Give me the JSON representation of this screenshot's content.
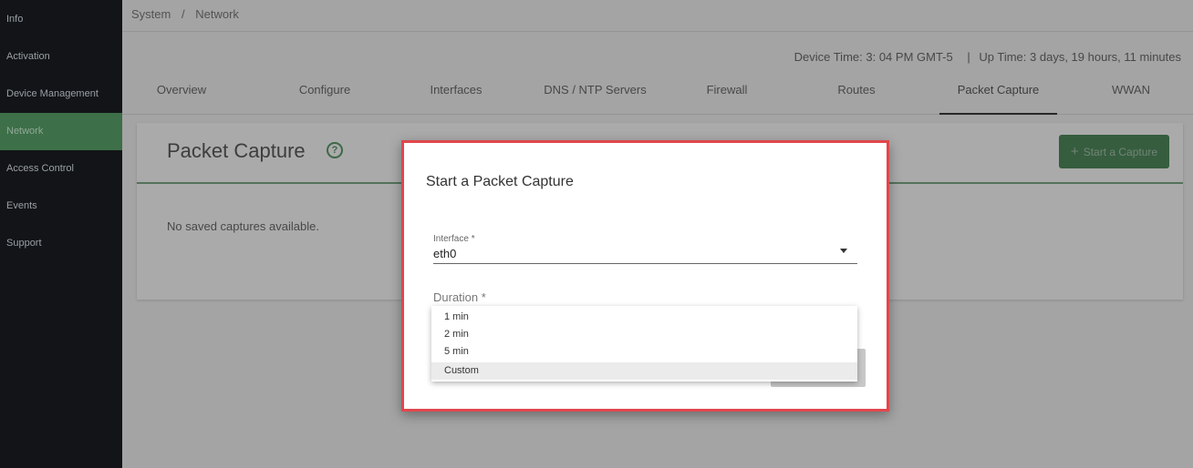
{
  "sidebar": {
    "items": [
      {
        "label": "Info"
      },
      {
        "label": "Activation"
      },
      {
        "label": "Device Management"
      },
      {
        "label": "Network"
      },
      {
        "label": "Access Control"
      },
      {
        "label": "Events"
      },
      {
        "label": "Support"
      }
    ],
    "active_index": 3
  },
  "breadcrumb": {
    "root": "System",
    "separator": "/",
    "current": "Network"
  },
  "status": {
    "device_time_label": "Device Time:",
    "device_time_value": "3: 04 PM GMT-5",
    "separator": "|",
    "uptime_label": "Up Time:",
    "uptime_value": "3 days, 19 hours, 11 minutes"
  },
  "tabs": [
    {
      "label": "Overview"
    },
    {
      "label": "Configure"
    },
    {
      "label": "Interfaces"
    },
    {
      "label": "DNS / NTP Servers"
    },
    {
      "label": "Firewall"
    },
    {
      "label": "Routes"
    },
    {
      "label": "Packet Capture"
    },
    {
      "label": "WWAN"
    }
  ],
  "active_tab": "Packet Capture",
  "card": {
    "title": "Packet Capture",
    "help_icon": "help-circle-icon",
    "start_button_label": "Start a Capture",
    "start_button_icon": "+",
    "empty_message": "No saved captures available."
  },
  "dialog": {
    "title": "Start a Packet Capture",
    "interface_label": "Interface *",
    "interface_value": "eth0",
    "duration_label": "Duration *",
    "duration_options": [
      {
        "label": "1 min"
      },
      {
        "label": "2 min"
      },
      {
        "label": "5 min"
      },
      {
        "label": "Custom"
      }
    ],
    "highlighted_option": "Custom"
  },
  "colors": {
    "sidebar_bg": "#121417",
    "accent_green": "#4f8a5c",
    "dialog_border": "#e0474c"
  }
}
